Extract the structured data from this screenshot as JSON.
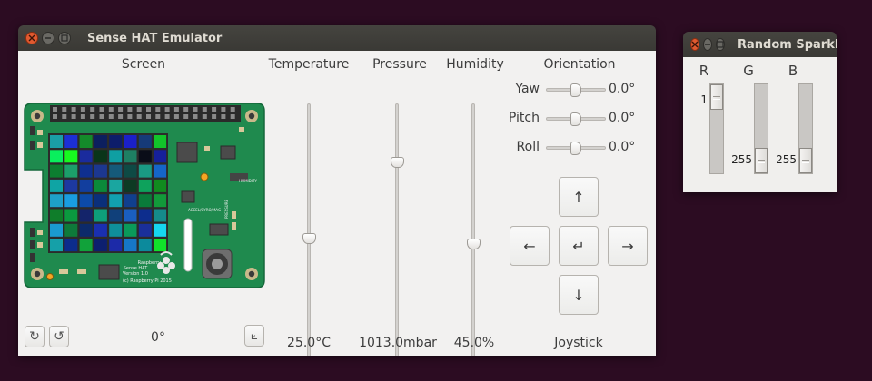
{
  "main_window": {
    "title": "Sense HAT Emulator",
    "screen": {
      "label": "Screen",
      "rotation": "0°",
      "rotate_cw_icon": "rotate-clockwise-icon",
      "rotate_ccw_icon": "rotate-counterclockwise-icon",
      "orient_icon": "orientation-icon",
      "pcb": {
        "text_line1": "Raspberry Pi",
        "text_line2": "Sense HAT",
        "text_line3": "Version 1.0",
        "text_line4": "(c) Raspberry Pi 2015",
        "label_accel": "ACCEL/GYRO/MAG",
        "label_humidity": "HUMIDITY",
        "label_pressure": "PRESSURE"
      },
      "led_colors": [
        [
          "#1a9ea6",
          "#1c2fd6",
          "#148a2a",
          "#0c1f5e",
          "#0d1d6a",
          "#1b20c8",
          "#163a78",
          "#12c42a"
        ],
        [
          "#09ef5d",
          "#17f91f",
          "#1a2b9d",
          "#0a3519",
          "#0f9fa2",
          "#1e7f63",
          "#0a0d18",
          "#16209a"
        ],
        [
          "#0c7e30",
          "#1c9f6a",
          "#0f2f8f",
          "#1c3790",
          "#155a7a",
          "#0e4a45",
          "#1a9a84",
          "#1565c8"
        ],
        [
          "#0fa4a4",
          "#1d39a0",
          "#123e9e",
          "#0b8a3a",
          "#1aa6a0",
          "#0d3a23",
          "#0ea25c",
          "#118a1f"
        ],
        [
          "#1ea0c8",
          "#199de0",
          "#0c4aa8",
          "#0a2f7a",
          "#12a0b0",
          "#103f8e",
          "#0a7a3a",
          "#129a3a"
        ],
        [
          "#0f7d2a",
          "#0b9a3f",
          "#14246a",
          "#0e9e7a",
          "#10407a",
          "#1a5ec0",
          "#0d2d8d",
          "#158a8a"
        ],
        [
          "#1a9acf",
          "#0e7a3a",
          "#0c2a6a",
          "#1a2fb0",
          "#0f8f9a",
          "#0a9a5a",
          "#1a2f9a",
          "#16d7f0"
        ],
        [
          "#15a0a8",
          "#0c2c8c",
          "#11a23a",
          "#0d1f6f",
          "#1c2aa8",
          "#1677c8",
          "#0c8a9c",
          "#11e22a"
        ]
      ]
    },
    "temperature": {
      "label": "Temperature",
      "value": "25.0°C",
      "level": 0.47
    },
    "pressure": {
      "label": "Pressure",
      "value": "1013.0mbar",
      "level": 0.78
    },
    "humidity": {
      "label": "Humidity",
      "value": "45.0%",
      "level": 0.45
    },
    "orientation": {
      "label": "Orientation",
      "rows": [
        {
          "name": "Yaw",
          "value": "0.0°",
          "level": 0.5
        },
        {
          "name": "Pitch",
          "value": "0.0°",
          "level": 0.5
        },
        {
          "name": "Roll",
          "value": "0.0°",
          "level": 0.5
        }
      ]
    },
    "joystick": {
      "label": "Joystick",
      "up": "↑",
      "left": "←",
      "enter": "↵",
      "right": "→",
      "down": "↓"
    }
  },
  "rgb_window": {
    "title": "Random Sparkles",
    "channels": [
      {
        "name": "R",
        "value": "1",
        "level": 0.0
      },
      {
        "name": "G",
        "value": "255",
        "level": 1.0
      },
      {
        "name": "B",
        "value": "255",
        "level": 1.0
      }
    ]
  }
}
